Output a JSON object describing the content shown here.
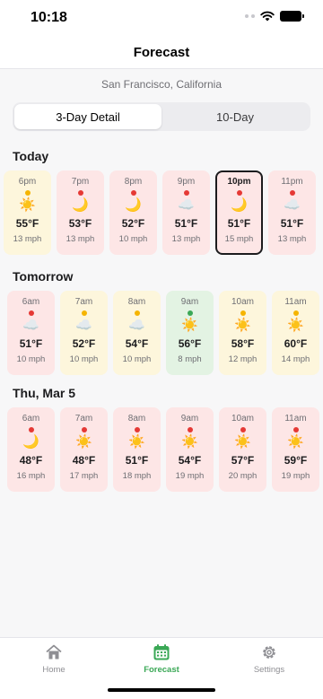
{
  "status": {
    "time": "10:18"
  },
  "nav": {
    "title": "Forecast"
  },
  "location": "San Francisco, California",
  "segments": [
    {
      "label": "3-Day Detail",
      "active": true
    },
    {
      "label": "10-Day",
      "active": false
    }
  ],
  "colors": {
    "pink": "#fde6e6",
    "yellow": "#fdf6dc",
    "green": "#e3f3e3",
    "dot_red": "#e53935",
    "dot_orange": "#f5b400",
    "dot_green": "#3aa856",
    "accent": "#3aa856"
  },
  "days": [
    {
      "label": "Today",
      "hours": [
        {
          "time": "6pm",
          "dot": "orange",
          "bg": "yellow",
          "icon": "sun-icon",
          "glyph": "☀️",
          "temp": "55°F",
          "wind": "13 mph"
        },
        {
          "time": "7pm",
          "dot": "red",
          "bg": "pink",
          "icon": "moon-icon",
          "glyph": "🌙",
          "temp": "53°F",
          "wind": "13 mph"
        },
        {
          "time": "8pm",
          "dot": "red",
          "bg": "pink",
          "icon": "moon-icon",
          "glyph": "🌙",
          "temp": "52°F",
          "wind": "10 mph"
        },
        {
          "time": "9pm",
          "dot": "red",
          "bg": "pink",
          "icon": "cloud-icon",
          "glyph": "☁️",
          "temp": "51°F",
          "wind": "13 mph"
        },
        {
          "time": "10pm",
          "dot": "red",
          "bg": "pink",
          "icon": "moon-icon",
          "glyph": "🌙",
          "temp": "51°F",
          "wind": "15 mph",
          "selected": true
        },
        {
          "time": "11pm",
          "dot": "red",
          "bg": "pink",
          "icon": "cloud-icon",
          "glyph": "☁️",
          "temp": "51°F",
          "wind": "13 mph"
        }
      ]
    },
    {
      "label": "Tomorrow",
      "hours": [
        {
          "time": "6am",
          "dot": "red",
          "bg": "pink",
          "icon": "cloud-icon",
          "glyph": "☁️",
          "temp": "51°F",
          "wind": "10 mph"
        },
        {
          "time": "7am",
          "dot": "orange",
          "bg": "yellow",
          "icon": "cloud-icon",
          "glyph": "☁️",
          "temp": "52°F",
          "wind": "10 mph"
        },
        {
          "time": "8am",
          "dot": "orange",
          "bg": "yellow",
          "icon": "cloud-icon",
          "glyph": "☁️",
          "temp": "54°F",
          "wind": "10 mph"
        },
        {
          "time": "9am",
          "dot": "green",
          "bg": "green",
          "icon": "sun-icon",
          "glyph": "☀️",
          "temp": "56°F",
          "wind": "8 mph"
        },
        {
          "time": "10am",
          "dot": "orange",
          "bg": "yellow",
          "icon": "sun-icon",
          "glyph": "☀️",
          "temp": "58°F",
          "wind": "12 mph"
        },
        {
          "time": "11am",
          "dot": "orange",
          "bg": "yellow",
          "icon": "sun-icon",
          "glyph": "☀️",
          "temp": "60°F",
          "wind": "14 mph"
        }
      ]
    },
    {
      "label": "Thu, Mar 5",
      "hours": [
        {
          "time": "6am",
          "dot": "red",
          "bg": "pink",
          "icon": "moon-icon",
          "glyph": "🌙",
          "temp": "48°F",
          "wind": "16 mph"
        },
        {
          "time": "7am",
          "dot": "red",
          "bg": "pink",
          "icon": "sun-icon",
          "glyph": "☀️",
          "temp": "48°F",
          "wind": "17 mph"
        },
        {
          "time": "8am",
          "dot": "red",
          "bg": "pink",
          "icon": "sun-icon",
          "glyph": "☀️",
          "temp": "51°F",
          "wind": "18 mph"
        },
        {
          "time": "9am",
          "dot": "red",
          "bg": "pink",
          "icon": "sun-icon",
          "glyph": "☀️",
          "temp": "54°F",
          "wind": "19 mph"
        },
        {
          "time": "10am",
          "dot": "red",
          "bg": "pink",
          "icon": "sun-icon",
          "glyph": "☀️",
          "temp": "57°F",
          "wind": "20 mph"
        },
        {
          "time": "11am",
          "dot": "red",
          "bg": "pink",
          "icon": "sun-icon",
          "glyph": "☀️",
          "temp": "59°F",
          "wind": "19 mph"
        }
      ]
    }
  ],
  "tabs": [
    {
      "label": "Home",
      "icon": "home-icon",
      "active": false
    },
    {
      "label": "Forecast",
      "icon": "calendar-icon",
      "active": true
    },
    {
      "label": "Settings",
      "icon": "gear-icon",
      "active": false
    }
  ]
}
